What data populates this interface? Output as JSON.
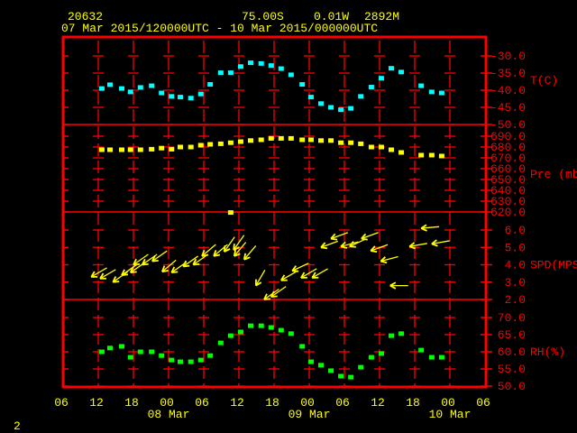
{
  "header": {
    "station": "20632",
    "lat": "75.00S",
    "lon": "0.01W",
    "elev": "2892M",
    "time_range": "07 Mar 2015/120000UTC - 10 Mar 2015/000000UTC"
  },
  "footer": {
    "page": "2"
  },
  "colors": {
    "frame": "#ff0000",
    "text": "#ffff00",
    "temp": "#00ffff",
    "pres": "#ffff00",
    "wind": "#ffff00",
    "rh": "#00ff00"
  },
  "chart_data": {
    "type": "scatter",
    "x_unit": "hours since 07 Mar 2015 06 UTC",
    "xlim": [
      0,
      72
    ],
    "x_ticks": [
      {
        "h": 0,
        "label": "06"
      },
      {
        "h": 6,
        "label": "12"
      },
      {
        "h": 12,
        "label": "18"
      },
      {
        "h": 18,
        "label": "00"
      },
      {
        "h": 24,
        "label": "06"
      },
      {
        "h": 30,
        "label": "12"
      },
      {
        "h": 36,
        "label": "18"
      },
      {
        "h": 42,
        "label": "00"
      },
      {
        "h": 48,
        "label": "06"
      },
      {
        "h": 54,
        "label": "12"
      },
      {
        "h": 60,
        "label": "18"
      },
      {
        "h": 66,
        "label": "00"
      },
      {
        "h": 72,
        "label": "06"
      }
    ],
    "date_labels": [
      {
        "h": 18,
        "label": "08 Mar"
      },
      {
        "h": 42,
        "label": "09 Mar"
      },
      {
        "h": 66,
        "label": "10 Mar"
      }
    ],
    "hours": [
      6.6,
      8.0,
      10.0,
      11.5,
      13.2,
      15.1,
      16.8,
      18.5,
      20.0,
      21.8,
      23.5,
      25.1,
      26.9,
      28.6,
      30.3,
      32.0,
      33.8,
      35.5,
      37.2,
      38.9,
      40.8,
      42.3,
      44.0,
      45.7,
      47.4,
      49.1,
      50.8,
      52.6,
      54.3,
      56.0,
      57.7,
      61.1,
      62.9,
      64.6
    ],
    "panels": [
      {
        "key": "temp",
        "label": "T(C)",
        "ylim": [
          -50,
          -30
        ],
        "ticks": [
          "-30.0",
          "-35.0",
          "-40.0",
          "-45.0",
          "-50.0"
        ],
        "tick_values": [
          -30,
          -35,
          -40,
          -45,
          -50
        ],
        "values": [
          -39.5,
          -38.4,
          -39.5,
          -40.5,
          -39.2,
          -38.7,
          -40.8,
          -41.8,
          -42.0,
          -42.3,
          -41.1,
          -38.3,
          -34.9,
          -34.9,
          -33.1,
          -32.0,
          -32.2,
          -32.8,
          -33.7,
          -35.5,
          -38.3,
          -42.0,
          -43.9,
          -45.0,
          -45.7,
          -45.3,
          -41.8,
          -39.1,
          -36.5,
          -33.6,
          -34.7,
          -38.7,
          -40.5,
          -40.8
        ]
      },
      {
        "key": "pres",
        "label": "Pre (mb)",
        "ylim": [
          620,
          690
        ],
        "ticks": [
          "690.0",
          "680.0",
          "670.0",
          "660.0",
          "650.0",
          "640.0",
          "630.0",
          "620.0"
        ],
        "tick_values": [
          690,
          680,
          670,
          660,
          650,
          640,
          630,
          620
        ],
        "values": [
          677.5,
          677.5,
          677.5,
          677.5,
          677.5,
          678,
          679,
          678,
          680,
          680,
          681.7,
          682.5,
          683,
          684,
          685,
          686,
          686.7,
          688,
          688,
          688,
          686.7,
          686.7,
          686,
          686,
          684,
          684,
          683,
          680,
          680,
          677.5,
          675,
          672.5,
          672.5,
          671.7
        ],
        "extra_points": [
          {
            "h": 28.6,
            "value": 619.5
          }
        ]
      },
      {
        "key": "wind",
        "label": "SPD(MPS)",
        "ylim": [
          2,
          6
        ],
        "ticks": [
          "6.0",
          "5.0",
          "4.0",
          "3.0",
          "2.0"
        ],
        "tick_values": [
          6,
          5,
          4,
          3,
          2
        ],
        "arrows": [
          {
            "h": 4.8,
            "spd": 3.3,
            "dir": 60
          },
          {
            "h": 6.3,
            "spd": 3.2,
            "dir": 60
          },
          {
            "h": 8.5,
            "spd": 3.0,
            "dir": 55
          },
          {
            "h": 10.0,
            "spd": 3.4,
            "dir": 55
          },
          {
            "h": 11.5,
            "spd": 3.55,
            "dir": 55
          },
          {
            "h": 12.0,
            "spd": 4.0,
            "dir": 55
          },
          {
            "h": 13.5,
            "spd": 4.0,
            "dir": 55
          },
          {
            "h": 15.2,
            "spd": 4.2,
            "dir": 55
          },
          {
            "h": 16.9,
            "spd": 3.6,
            "dir": 50
          },
          {
            "h": 18.5,
            "spd": 3.55,
            "dir": 55
          },
          {
            "h": 20.5,
            "spd": 3.9,
            "dir": 55
          },
          {
            "h": 22.2,
            "spd": 4.0,
            "dir": 55
          },
          {
            "h": 23.7,
            "spd": 4.5,
            "dir": 50
          },
          {
            "h": 25.7,
            "spd": 4.5,
            "dir": 50
          },
          {
            "h": 27.5,
            "spd": 4.75,
            "dir": 35
          },
          {
            "h": 29.1,
            "spd": 4.85,
            "dir": 35
          },
          {
            "h": 29.2,
            "spd": 4.5,
            "dir": 40
          },
          {
            "h": 30.9,
            "spd": 4.3,
            "dir": 40
          },
          {
            "h": 32.9,
            "spd": 2.8,
            "dir": 30
          },
          {
            "h": 34.3,
            "spd": 2.0,
            "dir": 55
          },
          {
            "h": 35.5,
            "spd": 2.15,
            "dir": 55
          },
          {
            "h": 37.2,
            "spd": 3.1,
            "dir": 60
          },
          {
            "h": 39.1,
            "spd": 3.65,
            "dir": 65
          },
          {
            "h": 40.6,
            "spd": 3.25,
            "dir": 60
          },
          {
            "h": 42.5,
            "spd": 3.25,
            "dir": 60
          },
          {
            "h": 44.0,
            "spd": 5.0,
            "dir": 70
          },
          {
            "h": 45.7,
            "spd": 5.5,
            "dir": 70
          },
          {
            "h": 47.4,
            "spd": 5.05,
            "dir": 75
          },
          {
            "h": 48.9,
            "spd": 5.05,
            "dir": 65
          },
          {
            "h": 50.9,
            "spd": 5.5,
            "dir": 70
          },
          {
            "h": 52.5,
            "spd": 4.8,
            "dir": 70
          },
          {
            "h": 54.2,
            "spd": 4.2,
            "dir": 75
          },
          {
            "h": 55.8,
            "spd": 2.8,
            "dir": 90
          },
          {
            "h": 59.1,
            "spd": 5.05,
            "dir": 80
          },
          {
            "h": 61.1,
            "spd": 6.1,
            "dir": 85
          },
          {
            "h": 62.9,
            "spd": 5.2,
            "dir": 80
          }
        ]
      },
      {
        "key": "rh",
        "label": "RH(%)",
        "ylim": [
          50,
          70
        ],
        "ticks": [
          "70.0",
          "65.0",
          "60.0",
          "55.0",
          "50.0"
        ],
        "tick_values": [
          70,
          65,
          60,
          55,
          50
        ],
        "values": [
          60.0,
          61.1,
          61.6,
          58.4,
          60.0,
          60.0,
          58.9,
          57.6,
          57.1,
          57.1,
          57.6,
          58.9,
          62.6,
          64.7,
          65.8,
          67.6,
          67.6,
          67.1,
          66.3,
          65.3,
          61.6,
          57.1,
          56.1,
          54.5,
          52.9,
          52.6,
          55.5,
          58.4,
          59.5,
          64.7,
          65.3,
          60.5,
          58.4,
          58.4
        ]
      }
    ]
  }
}
